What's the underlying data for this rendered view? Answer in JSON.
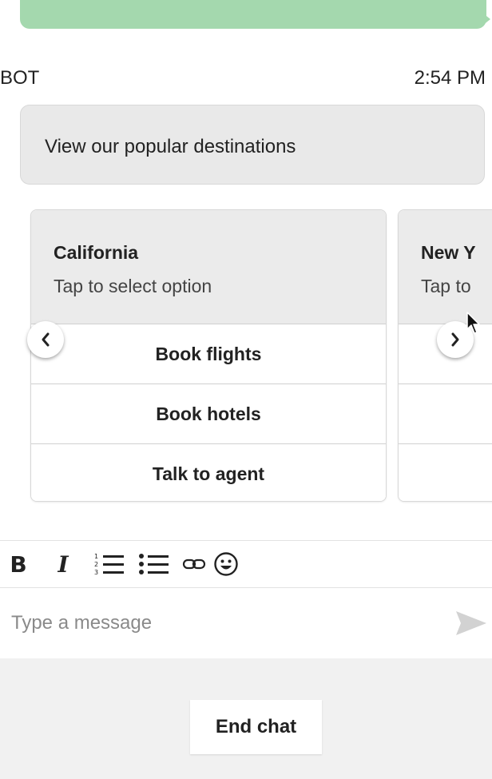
{
  "previous_message": {
    "bubble_color": "#a4d8ae"
  },
  "message": {
    "sender": "BOT",
    "time": "2:54 PM",
    "text": "View our popular destinations"
  },
  "carousel": {
    "cards": [
      {
        "title": "California",
        "subtitle": "Tap to select option",
        "buttons": [
          "Book flights",
          "Book hotels",
          "Talk to agent"
        ]
      },
      {
        "title": "New Y",
        "subtitle": "Tap to"
      }
    ],
    "prev_icon": "chevron-left-icon",
    "next_icon": "chevron-right-icon"
  },
  "toolbar": {
    "bold_label": "B",
    "italic_label": "I",
    "icons": [
      "bold-icon",
      "italic-icon",
      "numbered-list-icon",
      "bulleted-list-icon",
      "link-icon",
      "emoji-icon"
    ]
  },
  "composer": {
    "placeholder": "Type a message",
    "value": "",
    "send_icon": "send-icon"
  },
  "footer": {
    "end_chat_label": "End chat"
  }
}
